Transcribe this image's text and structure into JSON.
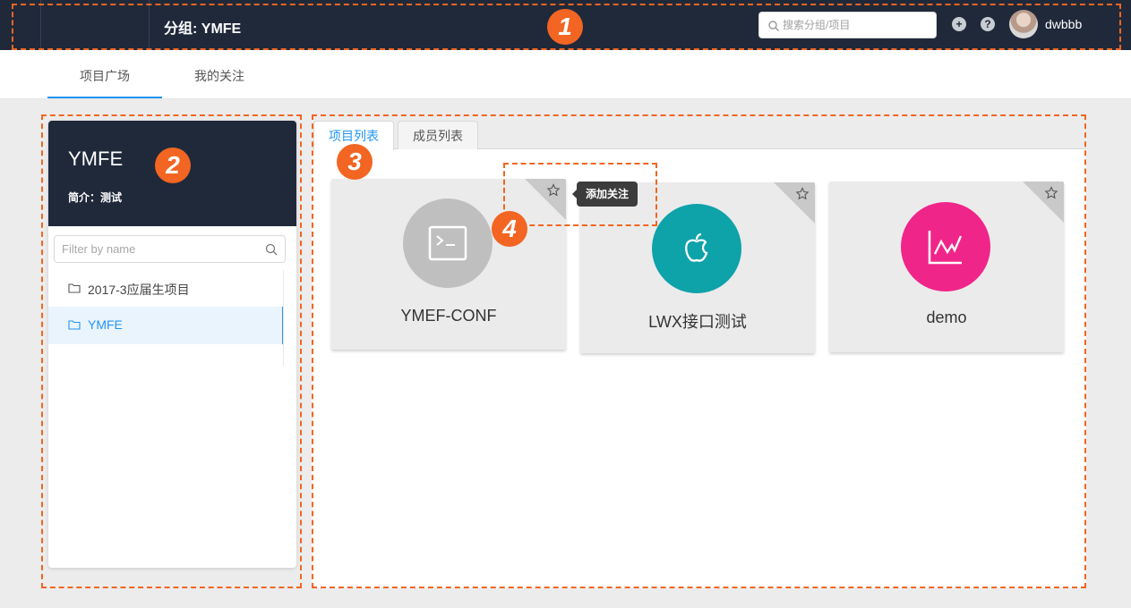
{
  "header": {
    "title": "分组: YMFE",
    "search_placeholder": "搜索分组/项目",
    "add_icon": "+",
    "help_icon": "?",
    "username": "dwbbb"
  },
  "nav": {
    "tabs": [
      "项目广场",
      "我的关注"
    ],
    "active_index": 0
  },
  "group": {
    "name": "YMFE",
    "description": "简介：测试",
    "filter_placeholder": "Filter by name",
    "items": [
      {
        "label": "2017-3应届生项目"
      },
      {
        "label": "YMFE"
      }
    ],
    "active_index": 1
  },
  "content": {
    "tabs": [
      "项目列表",
      "成员列表"
    ],
    "active_index": 0,
    "projects": [
      {
        "name": "YMEF-CONF",
        "icon": "terminal-icon",
        "color": "#bfbfbf"
      },
      {
        "name": "LWX接口测试",
        "icon": "apple-icon",
        "color": "#0ea2a9"
      },
      {
        "name": "demo",
        "icon": "line-chart-icon",
        "color": "#f0258a"
      }
    ],
    "tooltip": "添加关注"
  },
  "annotations": {
    "markers": [
      "1",
      "2",
      "3",
      "4"
    ],
    "color": "#f26522"
  }
}
